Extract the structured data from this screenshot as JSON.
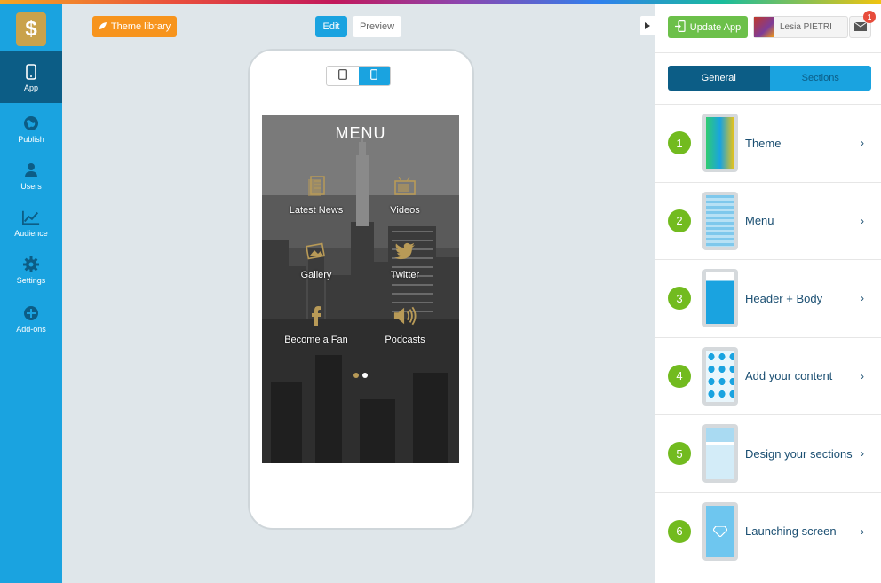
{
  "sidebar": {
    "logo_icon": "dollar-sign",
    "logo_glyph": "$",
    "items": [
      {
        "label": "App",
        "icon": "phone-icon",
        "active": true
      },
      {
        "label": "Publish",
        "icon": "globe-icon"
      },
      {
        "label": "Users",
        "icon": "user-icon"
      },
      {
        "label": "Audience",
        "icon": "chart-icon"
      },
      {
        "label": "Settings",
        "icon": "gear-icon"
      },
      {
        "label": "Add-ons",
        "icon": "plus-circle-icon"
      }
    ]
  },
  "toolbar": {
    "theme_library_label": "Theme library",
    "edit_label": "Edit",
    "preview_label": "Preview"
  },
  "preview": {
    "menu_title": "MENU",
    "tiles": [
      {
        "label": "Latest News",
        "icon": "newspaper-icon"
      },
      {
        "label": "Videos",
        "icon": "tv-icon"
      },
      {
        "label": "Gallery",
        "icon": "image-icon"
      },
      {
        "label": "Twitter",
        "icon": "twitter-bird-icon"
      },
      {
        "label": "Become a Fan",
        "icon": "facebook-icon"
      },
      {
        "label": "Podcasts",
        "icon": "speaker-icon"
      }
    ],
    "page_dots": 2,
    "active_dot": 1
  },
  "right_panel": {
    "update_label": "Update App",
    "user_name": "Lesia PIETRI",
    "mail_badge": "1",
    "tabs": [
      "General",
      "Sections"
    ],
    "steps": [
      {
        "num": "1",
        "label": "Theme"
      },
      {
        "num": "2",
        "label": "Menu"
      },
      {
        "num": "3",
        "label": "Header + Body"
      },
      {
        "num": "4",
        "label": "Add your content"
      },
      {
        "num": "5",
        "label": "Design your sections"
      },
      {
        "num": "6",
        "label": "Launching screen"
      }
    ]
  },
  "colors": {
    "accent": "#1aa3e0",
    "dark_accent": "#0c5d86",
    "orange": "#f7941d",
    "green": "#72bb1f",
    "gold_icon": "#b89a57"
  }
}
